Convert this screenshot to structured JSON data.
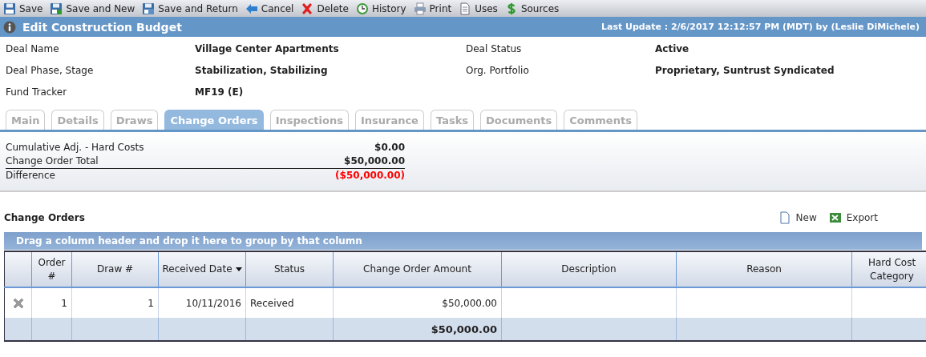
{
  "toolbar": [
    {
      "label": "Save",
      "kind": "save"
    },
    {
      "label": "Save and New",
      "kind": "save-new"
    },
    {
      "label": "Save and Return",
      "kind": "save-return"
    },
    {
      "label": "Cancel",
      "kind": "cancel"
    },
    {
      "label": "Delete",
      "kind": "delete"
    },
    {
      "label": "History",
      "kind": "history"
    },
    {
      "label": "Print",
      "kind": "print"
    },
    {
      "label": "Uses",
      "kind": "uses"
    },
    {
      "label": "Sources",
      "kind": "sources"
    }
  ],
  "header": {
    "title": "Edit Construction Budget",
    "last_update": "Last Update : 2/6/2017 12:12:57 PM (MDT) by (Leslie DiMichele)"
  },
  "fields": [
    {
      "label": "Deal Name",
      "value": "Village Center Apartments"
    },
    {
      "label": "Deal Status",
      "value": "Active"
    },
    {
      "label": "Deal Phase, Stage",
      "value": "Stabilization, Stabilizing"
    },
    {
      "label": "Org. Portfolio",
      "value": "Proprietary, Suntrust Syndicated"
    },
    {
      "label": "Fund Tracker",
      "value": "MF19 (E)"
    }
  ],
  "tabs": [
    {
      "label": "Main",
      "selected": false
    },
    {
      "label": "Details",
      "selected": false
    },
    {
      "label": "Draws",
      "selected": false
    },
    {
      "label": "Change Orders",
      "selected": true
    },
    {
      "label": "Inspections",
      "selected": false
    },
    {
      "label": "Insurance",
      "selected": false
    },
    {
      "label": "Tasks",
      "selected": false
    },
    {
      "label": "Documents",
      "selected": false
    },
    {
      "label": "Comments",
      "selected": false
    }
  ],
  "summary": [
    {
      "label": "Cumulative Adj. - Hard Costs",
      "value": "$0.00",
      "negative": false
    },
    {
      "label": "Change Order Total",
      "value": "$50,000.00",
      "negative": false
    },
    {
      "label": "Difference",
      "value": "($50,000.00)",
      "negative": true
    }
  ],
  "section": {
    "title": "Change Orders",
    "actions": [
      {
        "label": "New",
        "kind": "new"
      },
      {
        "label": "Export",
        "kind": "export"
      }
    ]
  },
  "grid": {
    "group_hint": "Drag a column header and drop it here to group by that column",
    "columns": [
      {
        "label": "Order #",
        "sorted": false
      },
      {
        "label": "Draw #",
        "sorted": false
      },
      {
        "label": "Received Date",
        "sorted": true
      },
      {
        "label": "Status",
        "sorted": false
      },
      {
        "label": "Change Order Amount",
        "sorted": false
      },
      {
        "label": "Description",
        "sorted": false
      },
      {
        "label": "Reason",
        "sorted": false
      },
      {
        "label": "Hard Cost Category",
        "sorted": false
      }
    ],
    "rows": [
      {
        "cells": [
          "1",
          "1",
          "10/11/2016",
          "Received",
          "$50,000.00",
          null,
          null,
          null
        ]
      }
    ],
    "amount_total": "$50,000.00"
  }
}
